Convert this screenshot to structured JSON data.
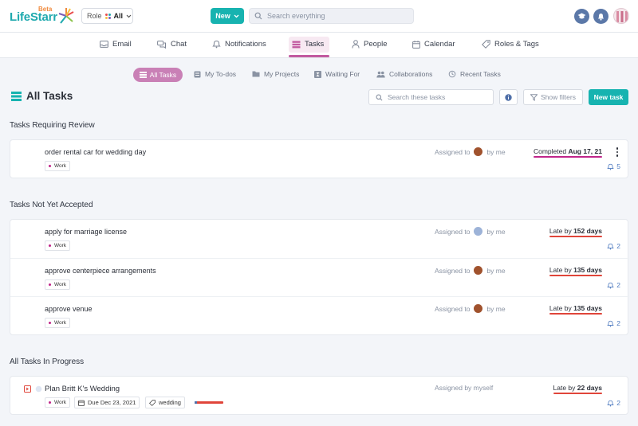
{
  "app": {
    "name": "LifeStarr",
    "badge": "Beta"
  },
  "topbar": {
    "role_label": "Role",
    "role_value": "All",
    "new_button": "New",
    "search_placeholder": "Search everything"
  },
  "nav": {
    "items": [
      {
        "label": "Email",
        "icon": "mail-icon"
      },
      {
        "label": "Chat",
        "icon": "chat-icon"
      },
      {
        "label": "Notifications",
        "icon": "bell-icon"
      },
      {
        "label": "Tasks",
        "icon": "tasks-icon",
        "active": true
      },
      {
        "label": "People",
        "icon": "person-icon"
      },
      {
        "label": "Calendar",
        "icon": "calendar-icon"
      },
      {
        "label": "Roles & Tags",
        "icon": "tag-icon"
      }
    ]
  },
  "subnav": {
    "items": [
      {
        "label": "All Tasks",
        "active": true
      },
      {
        "label": "My To-dos"
      },
      {
        "label": "My Projects"
      },
      {
        "label": "Waiting For"
      },
      {
        "label": "Collaborations"
      },
      {
        "label": "Recent Tasks"
      }
    ]
  },
  "page": {
    "title": "All Tasks",
    "search_placeholder": "Search these tasks",
    "filters_label": "Show filters",
    "new_task_label": "New task"
  },
  "colors": {
    "accent": "#17b3b0",
    "brand_pink": "#c25aa0",
    "late_line": "#e0453a",
    "done_line": "#c0258a"
  },
  "sections": [
    {
      "title": "Tasks Requiring Review",
      "tasks": [
        {
          "name": "order rental car for wedding day",
          "tag": "Work",
          "assigned_prefix": "Assigned to",
          "assigned_suffix": "by me",
          "status_prefix": "Completed",
          "status_value": "Aug 17, 21",
          "count": "5"
        }
      ]
    },
    {
      "title": "Tasks Not Yet Accepted",
      "tasks": [
        {
          "name": "apply for marriage license",
          "tag": "Work",
          "assigned_prefix": "Assigned to",
          "assigned_suffix": "by me",
          "status_prefix": "Late by",
          "status_value": "152 days",
          "count": "2"
        },
        {
          "name": "approve centerpiece arrangements",
          "tag": "Work",
          "assigned_prefix": "Assigned to",
          "assigned_suffix": "by me",
          "status_prefix": "Late by",
          "status_value": "135 days",
          "count": "2"
        },
        {
          "name": "approve venue",
          "tag": "Work",
          "assigned_prefix": "Assigned to",
          "assigned_suffix": "by me",
          "status_prefix": "Late by",
          "status_value": "135 days",
          "count": "2"
        }
      ]
    },
    {
      "title": "All Tasks In Progress",
      "tasks": [
        {
          "name": "Plan Britt K's Wedding",
          "tag": "Work",
          "due": "Due Dec 23, 2021",
          "tag2": "wedding",
          "assigned_text": "Assigned by myself",
          "status_prefix": "Late by",
          "status_value": "22 days",
          "count": "2"
        }
      ]
    }
  ]
}
